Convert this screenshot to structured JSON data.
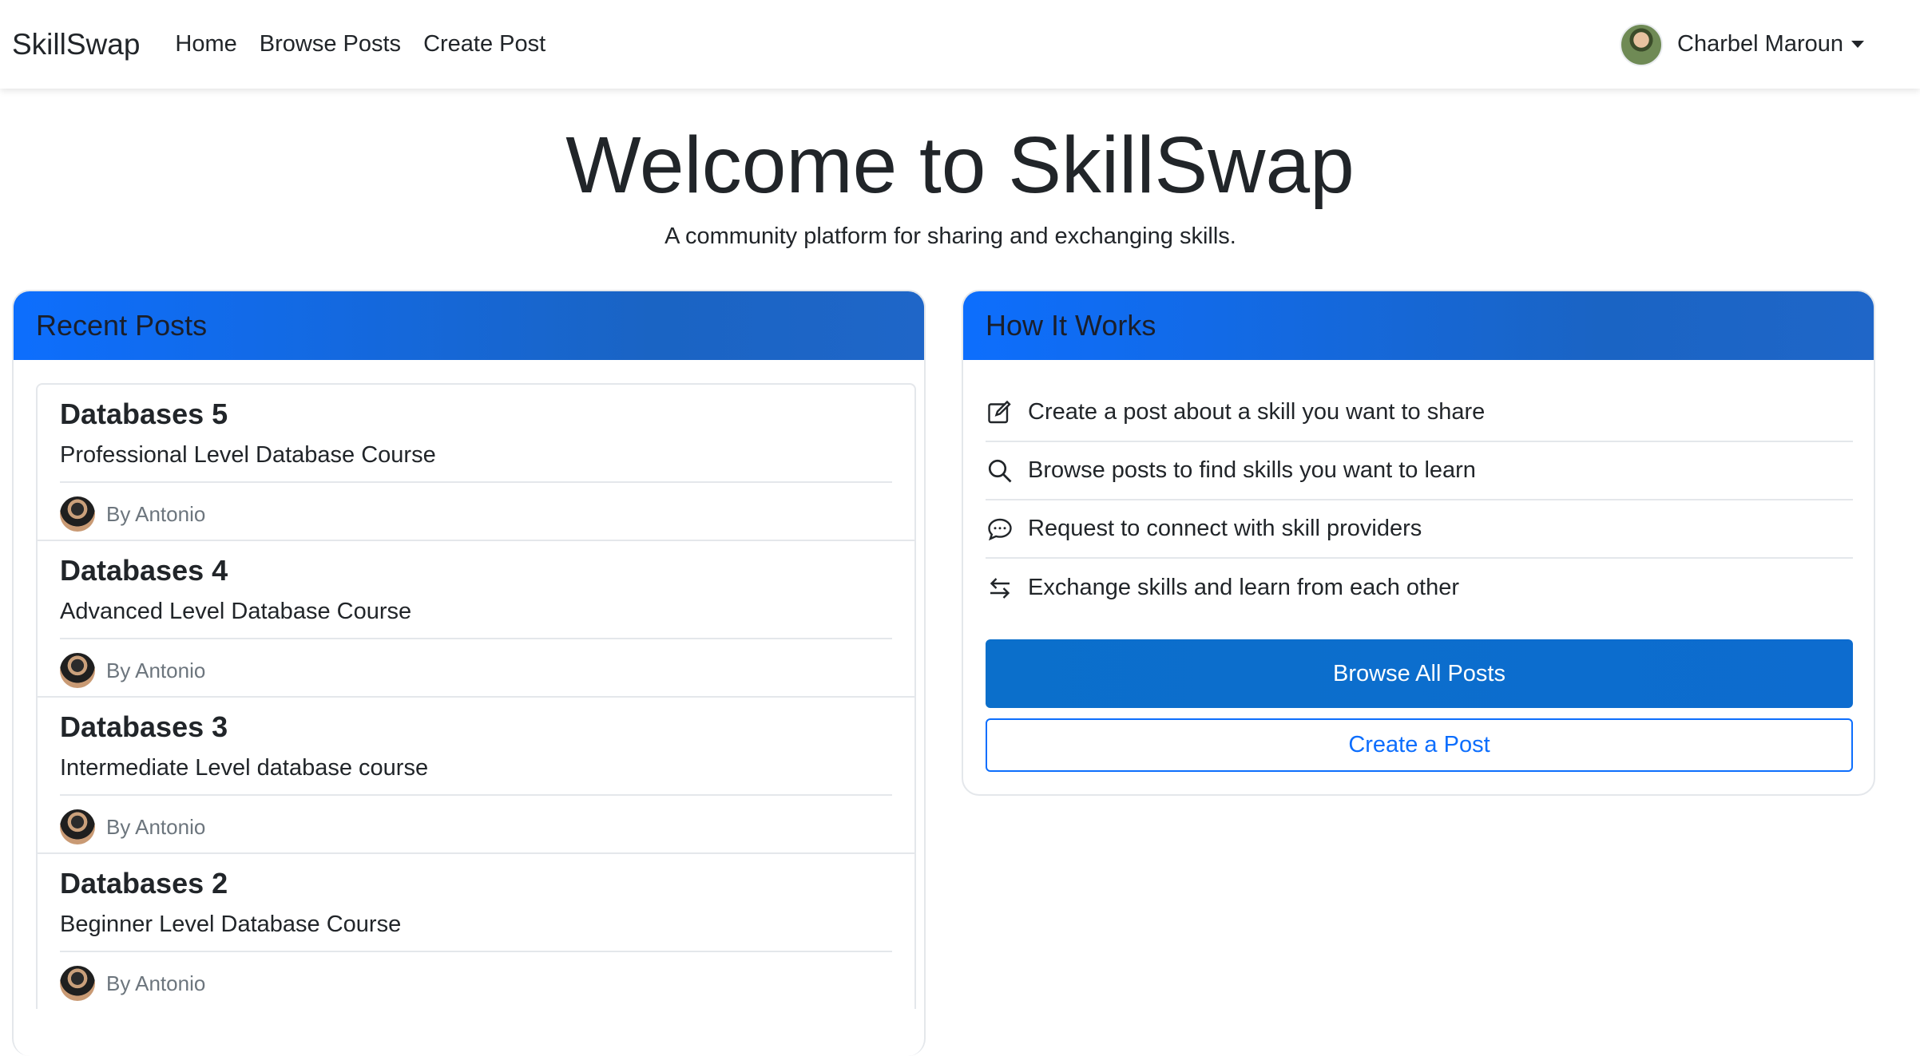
{
  "navbar": {
    "brand": "SkillSwap",
    "links": [
      "Home",
      "Browse Posts",
      "Create Post"
    ],
    "user_name": "Charbel Maroun"
  },
  "hero": {
    "title": "Welcome to SkillSwap",
    "subtitle": "A community platform for sharing and exchanging skills."
  },
  "recent": {
    "header": "Recent Posts",
    "posts": [
      {
        "title": "Databases 5",
        "desc": "Professional Level Database Course",
        "author": "By Antonio"
      },
      {
        "title": "Databases 4",
        "desc": "Advanced Level Database Course",
        "author": "By Antonio"
      },
      {
        "title": "Databases 3",
        "desc": "Intermediate Level database course",
        "author": "By Antonio"
      },
      {
        "title": "Databases 2",
        "desc": "Beginner Level Database Course",
        "author": "By Antonio"
      }
    ]
  },
  "how": {
    "header": "How It Works",
    "steps": [
      {
        "icon": "edit-icon",
        "text": "Create a post about a skill you want to share"
      },
      {
        "icon": "search-icon",
        "text": "Browse posts to find skills you want to learn"
      },
      {
        "icon": "chat-icon",
        "text": "Request to connect with skill providers"
      },
      {
        "icon": "exchange-icon",
        "text": "Exchange skills and learn from each other"
      }
    ],
    "browse_button": "Browse All Posts",
    "create_button": "Create a Post"
  },
  "colors": {
    "primary": "#0d6efd",
    "header_gradient_end": "#1f66c8",
    "muted": "#6c757d"
  }
}
